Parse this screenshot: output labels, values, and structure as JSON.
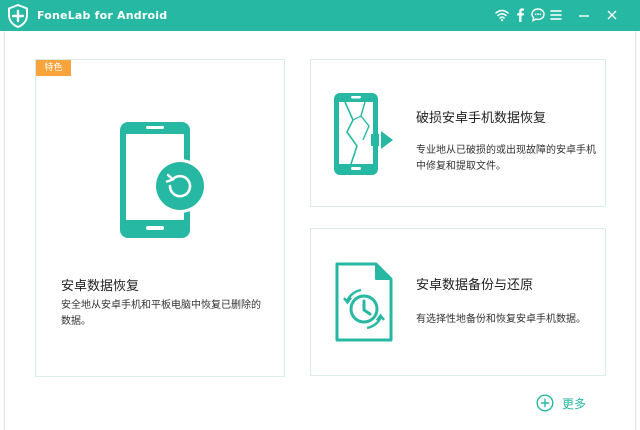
{
  "app": {
    "title": "FoneLab for Android"
  },
  "colors": {
    "accent": "#27b8a3",
    "badge": "#f6a43b"
  },
  "titlebar_icons": [
    "wifi-icon",
    "facebook-icon",
    "chat-icon",
    "menu-icon",
    "minimize-icon",
    "close-icon"
  ],
  "cards": {
    "recovery": {
      "badge": "特色",
      "title": "安卓数据恢复",
      "desc": "安全地从安卓手机和平板电脑中恢复已删除的数据。",
      "icon": "phone-restore-icon"
    },
    "broken": {
      "title": "破损安卓手机数据恢复",
      "desc": "专业地从已破损的或出现故障的安卓手机中修复和提取文件。",
      "icon": "broken-phone-icon"
    },
    "backup": {
      "title": "安卓数据备份与还原",
      "desc": "有选择性地备份和恢复安卓手机数据。",
      "icon": "backup-file-icon"
    }
  },
  "more": {
    "label": "更多",
    "icon": "plus-circle-icon"
  }
}
